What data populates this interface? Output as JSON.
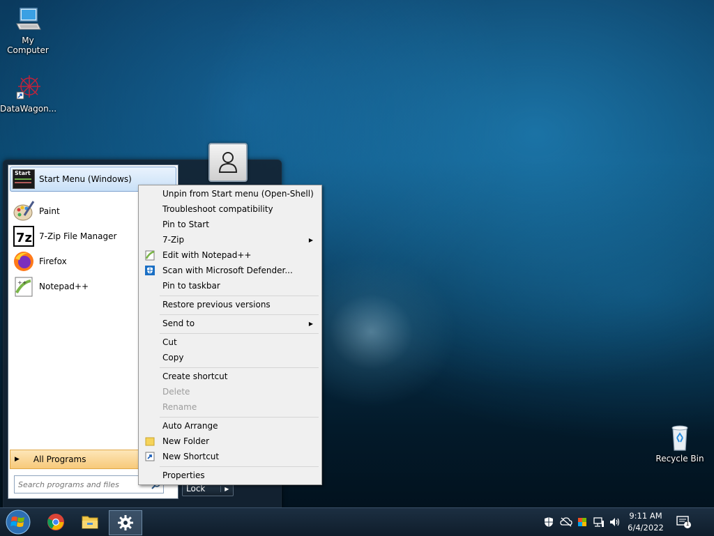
{
  "desktop": {
    "icons": [
      {
        "label": "My Computer"
      },
      {
        "label": "DataWagon..."
      },
      {
        "label": "Recycle Bin"
      }
    ]
  },
  "start_menu": {
    "header": {
      "badge": "Start",
      "label": "Start Menu (Windows)"
    },
    "programs": [
      {
        "label": "Paint",
        "icon": "paint-icon"
      },
      {
        "label": "7-Zip File Manager",
        "icon": "7zip-icon"
      },
      {
        "label": "Firefox",
        "icon": "firefox-icon"
      },
      {
        "label": "Notepad++",
        "icon": "notepadpp-icon"
      }
    ],
    "all_programs": "All Programs",
    "search_placeholder": "Search programs and files",
    "lock_label": "Lock"
  },
  "context_menu": {
    "items": [
      {
        "label": "Unpin from Start menu (Open-Shell)"
      },
      {
        "label": "Troubleshoot compatibility"
      },
      {
        "label": "Pin to Start"
      },
      {
        "label": "7-Zip"
      },
      {
        "label": "Edit with Notepad++"
      },
      {
        "label": "Scan with Microsoft Defender..."
      },
      {
        "label": "Pin to taskbar"
      },
      {
        "label": "Restore previous versions"
      },
      {
        "label": "Send to"
      },
      {
        "label": "Cut"
      },
      {
        "label": "Copy"
      },
      {
        "label": "Create shortcut"
      },
      {
        "label": "Delete"
      },
      {
        "label": "Rename"
      },
      {
        "label": "Auto Arrange"
      },
      {
        "label": "New Folder"
      },
      {
        "label": "New Shortcut"
      },
      {
        "label": "Properties"
      }
    ]
  },
  "taskbar": {
    "clock_time": "9:11 AM",
    "clock_date": "6/4/2022",
    "notification_count": "1"
  }
}
